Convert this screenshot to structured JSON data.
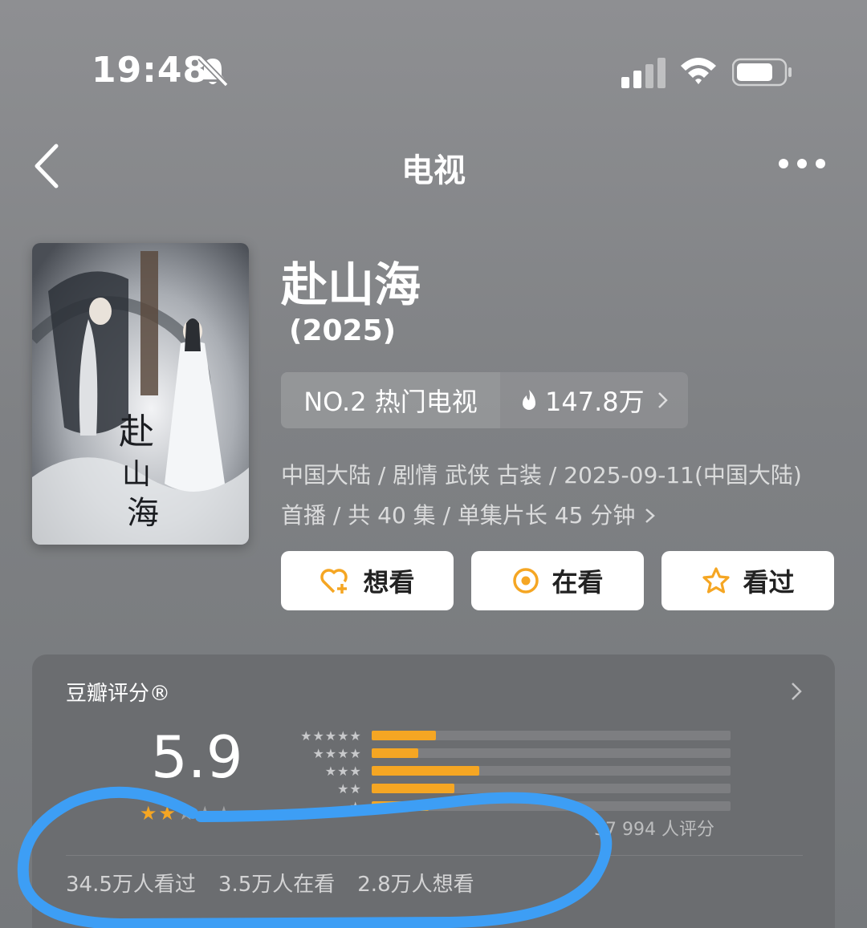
{
  "status_bar": {
    "time": "19:48"
  },
  "nav": {
    "title": "电视"
  },
  "show": {
    "title": "赴山海",
    "year": "(2025)",
    "rank_label": "NO.2 热门电视",
    "heat": "147.8万",
    "meta_line1": "中国大陆 / 剧情 武侠 古装 / 2025-09-11(中国大陆)",
    "meta_line2": "首播 / 共 40 集 / 单集片长 45 分钟"
  },
  "buttons": {
    "want": "想看",
    "watching": "在看",
    "watched": "看过"
  },
  "rating": {
    "title": "豆瓣评分®",
    "score": "5.9",
    "count": "37 994 人评分",
    "distribution": [
      {
        "stars": "★★★★★",
        "fraction": 0.18
      },
      {
        "stars": "★★★★",
        "fraction": 0.13
      },
      {
        "stars": "★★★",
        "fraction": 0.3
      },
      {
        "stars": "★★",
        "fraction": 0.23
      },
      {
        "stars": "★",
        "fraction": 0.16
      }
    ],
    "watched": "34.5万人看过",
    "watching": "3.5万人在看",
    "want": "2.8万人想看"
  },
  "colors": {
    "accent": "#f5a623",
    "annotation": "#3d9ef5"
  }
}
